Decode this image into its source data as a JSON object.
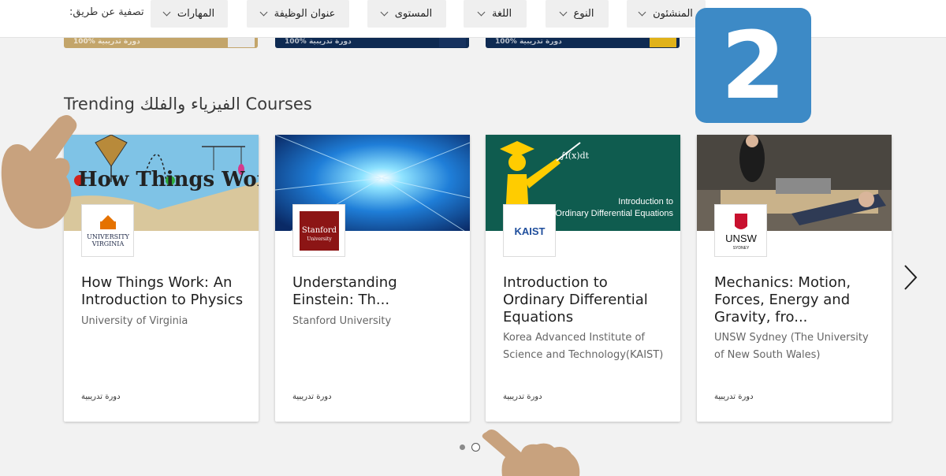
{
  "filters": {
    "label": "تصفية عن طريق:",
    "items": [
      {
        "label": "المهارات"
      },
      {
        "label": "عنوان الوظيفة"
      },
      {
        "label": "المستوى"
      },
      {
        "label": "اللغة"
      },
      {
        "label": "النوع"
      },
      {
        "label": "المنشئون"
      }
    ]
  },
  "prev_row": {
    "tags": [
      "100% دورة تدريبية",
      "100% دورة تدريبية",
      "100% دورة تدريبية"
    ]
  },
  "section": {
    "title": "Trending الفيزياء والفلك Courses"
  },
  "cards": [
    {
      "title": "How Things Work: An Introduction to Physics",
      "partner": "University of Virginia",
      "logo_text": "UNIVERSITY VIRGINIA",
      "type": "دورة تدريبية",
      "banner_text": "How Things Work"
    },
    {
      "title": "Understanding Einstein: Th...",
      "partner": "Stanford University",
      "logo_text": "Stanford",
      "logo_sub": "University",
      "type": "دورة تدريبية"
    },
    {
      "title": "Introduction to Ordinary Differential Equations",
      "partner": "Korea Advanced Institute of Science and Technology(KAIST)",
      "logo_text": "KAIST",
      "type": "دورة تدريبية",
      "banner_text_1": "Introduction to",
      "banner_text_2": "Ordinary Differential Equations",
      "banner_formula": "∫f(x)dt"
    },
    {
      "title": "Mechanics: Motion, Forces, Energy and Gravity, fro...",
      "partner": "UNSW Sydney (The University of New South Wales)",
      "logo_text": "UNSW",
      "logo_sub": "SYDNEY",
      "type": "دورة تدريبية"
    }
  ],
  "badge": {
    "text": "2"
  },
  "colors": {
    "badge": "#3d8ac6",
    "kaist_banner": "#0f5c4f",
    "stanford_red": "#8c1515",
    "virginia_orange": "#e57200"
  },
  "icons": [
    "chevron-down-icon",
    "chevron-right-icon",
    "pointing-hand-icon"
  ]
}
